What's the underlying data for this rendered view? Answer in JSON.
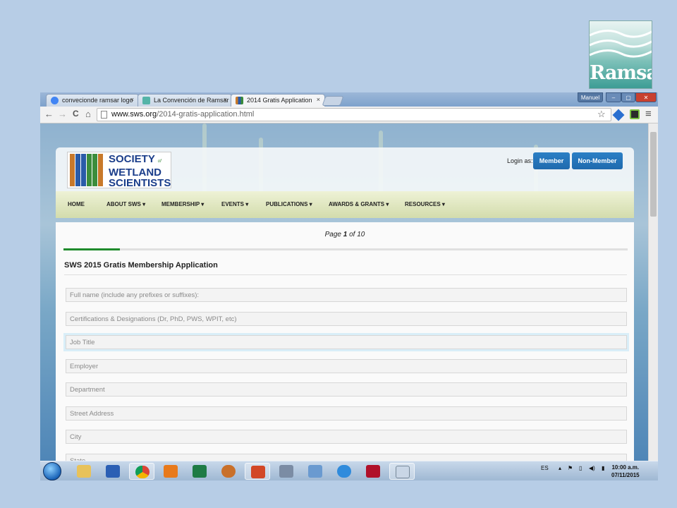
{
  "logo_corner": {
    "text": "Ramsar"
  },
  "browser": {
    "tabs": [
      {
        "label": "convecionde ramsar logo",
        "close": "×",
        "color": "#4285f4"
      },
      {
        "label": "La Convención de Ramsar",
        "close": "×",
        "color": "#54b4a8"
      },
      {
        "label": "2014 Gratis Application",
        "close": "×",
        "color": "#3a7a3a"
      }
    ],
    "window_buttons": {
      "profile": "Manuel",
      "minimize": "–",
      "maximize": "▢",
      "close": "✕"
    },
    "nav": {
      "back": "←",
      "forward": "→",
      "reload": "C",
      "home": "⌂"
    },
    "url_host": "www.sws.org",
    "url_path": "/2014-gratis-application.html",
    "toolbar_icons": {
      "star": "☆",
      "menu": "≡"
    }
  },
  "site": {
    "logo_lines": [
      "SOCIETY",
      "WETLAND",
      "SCIENTISTS"
    ],
    "logo_of": "of",
    "login_label": "Login as:",
    "member_button": "Member",
    "nonmember_button": "Non-Member",
    "nav": [
      "HOME",
      "ABOUT SWS ▾",
      "MEMBERSHIP ▾",
      "EVENTS ▾",
      "PUBLICATIONS ▾",
      "AWARDS & GRANTS ▾",
      "RESOURCES ▾"
    ]
  },
  "form": {
    "pager_prefix": "Page ",
    "pager_current": "1",
    "pager_suffix": " of 10",
    "progress_fraction": 0.1,
    "title": "SWS 2015 Gratis Membership Application",
    "fields": [
      "Full name (include any prefixes or suffixes):",
      "Certifications & Designations (Dr, PhD, PWS, WPIT, etc)",
      "Job Title",
      "Employer",
      "Department",
      "Street Address",
      "City",
      "State"
    ]
  },
  "taskbar": {
    "language": "ES",
    "time": "10:00 a.m.",
    "date": "07/11/2015",
    "apps": [
      "folder",
      "word",
      "chrome",
      "media",
      "excel",
      "baseball",
      "powerpoint",
      "calculator",
      "network",
      "ie",
      "mendeley",
      "snipping"
    ]
  }
}
